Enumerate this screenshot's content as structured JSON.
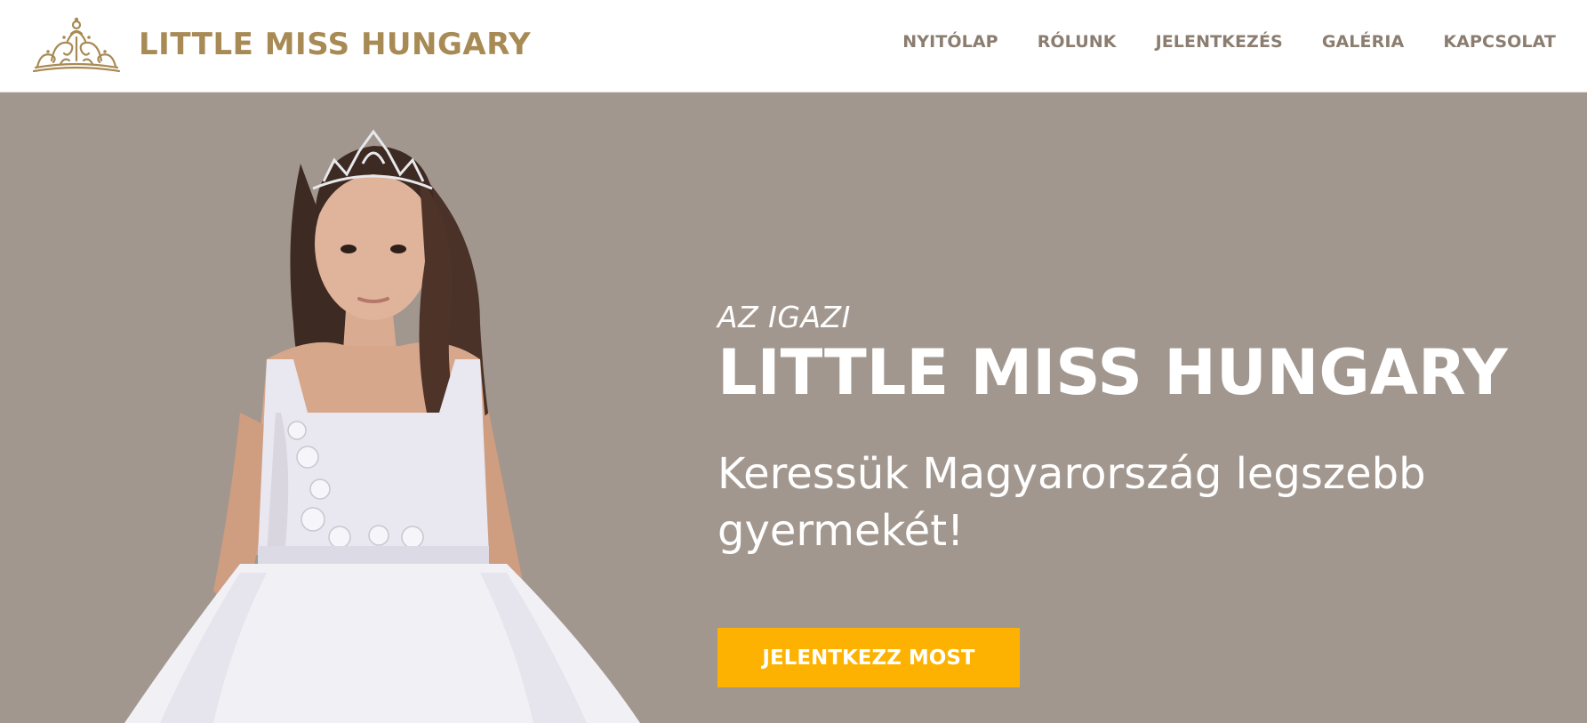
{
  "header": {
    "brand": "LITTLE MISS HUNGARY",
    "logo_icon": "tiara-icon",
    "nav": [
      {
        "label": "NYITÓLAP"
      },
      {
        "label": "RÓLUNK"
      },
      {
        "label": "JELENTKEZÉS"
      },
      {
        "label": "GALÉRIA"
      },
      {
        "label": "KAPCSOLAT"
      }
    ]
  },
  "hero": {
    "kicker": "AZ IGAZI",
    "title": "LITTLE MISS HUNGARY",
    "subtitle": "Keressük Magyarország legszebb gyermekét!",
    "cta_label": "JELENTKEZZ MOST",
    "image_subject": "girl in white dress wearing a tiara"
  },
  "colors": {
    "brand_gold": "#a88a55",
    "nav_text": "#8b7d70",
    "hero_bg": "#a2978e",
    "cta_bg": "#fdb201",
    "hero_text": "#ffffff"
  }
}
